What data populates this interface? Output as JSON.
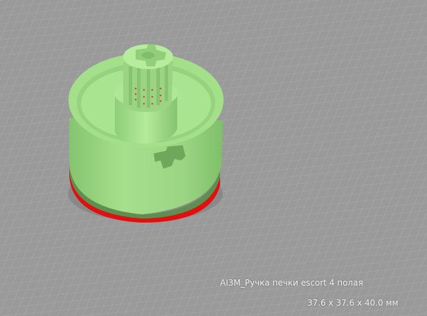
{
  "viewport": {
    "background_color": "#9a9a9a",
    "grid_line_color": "#b8b8b8",
    "model_color": "#a4e08a",
    "model_shadow_color": "#7fbf69",
    "bottom_layer_color": "#e01010"
  },
  "model": {
    "name": "AI3M_Ручка печки escort 4 полая",
    "dimensions": "37.6 x 37.6 x 40.0 мм"
  }
}
